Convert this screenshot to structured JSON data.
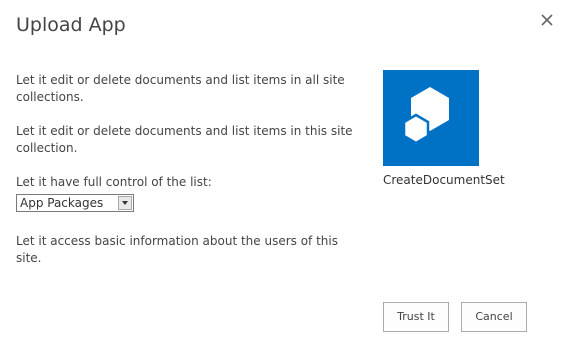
{
  "dialog": {
    "title": "Upload App",
    "close_icon": "close-icon"
  },
  "permissions": {
    "items": [
      "Let it edit or delete documents and list items in all site collections.",
      "Let it edit or delete documents and list items in this site collection.",
      "Let it have full control of the list:",
      "Let it access basic information about the users of this site."
    ],
    "list_select": {
      "value": "App Packages",
      "arrow_icon": "dropdown-arrow-icon"
    }
  },
  "app": {
    "name": "CreateDocumentSet",
    "icon": "app-tile-icon",
    "tile_color": "#0072c6"
  },
  "buttons": {
    "trust_label": "Trust It",
    "cancel_label": "Cancel"
  }
}
